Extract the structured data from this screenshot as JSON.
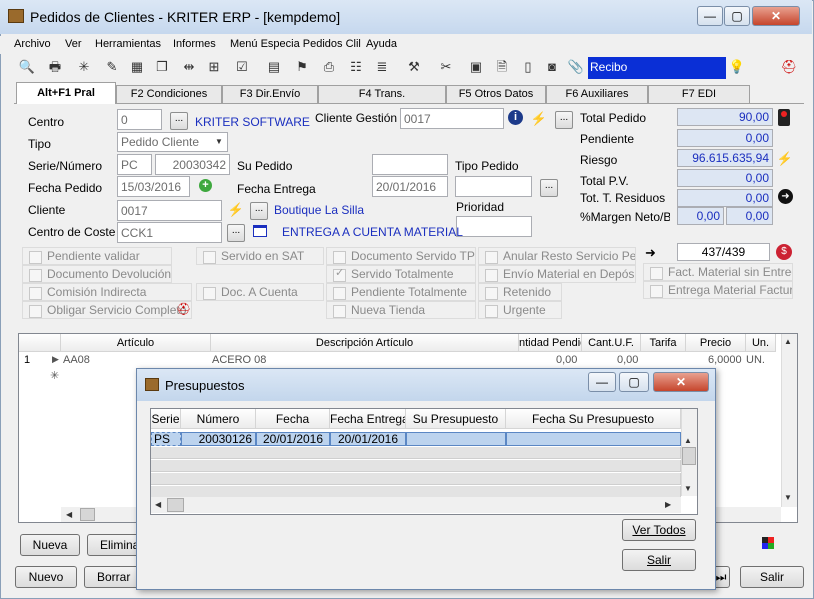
{
  "window": {
    "title": "Pedidos de Clientes - KRITER ERP - [kempdemo]",
    "controls": [
      "—",
      "▢",
      "✕"
    ]
  },
  "menu": [
    "Archivo",
    "Ver",
    "Herramientas",
    "Informes",
    "Menú Especia Pedidos Clil",
    "Ayuda"
  ],
  "toolbar": {
    "recibo_label": "Recibo"
  },
  "tabs": [
    "Alt+F1 Pral",
    "F2 Condiciones",
    "F3 Dir.Envío",
    "F4 Trans.",
    "F5 Otros Datos",
    "F6 Auxiliares",
    "F7 EDI"
  ],
  "form": {
    "centro_label": "Centro",
    "centro_value": "0",
    "centro_name": "KRITER SOFTWARE",
    "cliente_gestion_label": "Cliente Gestión",
    "cliente_gestion_value": "0017",
    "tipo_label": "Tipo",
    "tipo_value": "Pedido Cliente",
    "serie_label": "Serie/Número",
    "serie_value": "PC",
    "numero_value": "20030342",
    "su_pedido_label": "Su Pedido",
    "tipo_pedido_label": "Tipo Pedido",
    "fecha_pedido_label": "Fecha Pedido",
    "fecha_pedido_value": "15/03/2016",
    "fecha_entrega_label": "Fecha Entrega",
    "fecha_entrega_value": "20/01/2016",
    "prioridad_label": "Prioridad",
    "cliente_label": "Cliente",
    "cliente_value": "0017",
    "cliente_name": "Boutique La Silla",
    "centro_coste_label": "Centro de Coste",
    "centro_coste_value": "CCK1",
    "centro_coste_name": "ENTREGA A CUENTA MATERIAL"
  },
  "totals": {
    "total_pedido_label": "Total Pedido",
    "total_pedido_value": "90,00",
    "pendiente_label": "Pendiente",
    "pendiente_value": "0,00",
    "riesgo_label": "Riesgo",
    "riesgo_value": "96.615.635,94",
    "total_pv_label": "Total P.V.",
    "total_pv_value": "0,00",
    "tot_residuos_label": "Tot. T. Residuos",
    "tot_residuos_value": "0,00",
    "margen_label": "%Margen Neto/Br",
    "margen_neto_value": "0,00",
    "margen_bruto_value": "0,00",
    "counter": "437/439"
  },
  "checkboxes": {
    "col1": [
      "Pendiente validar",
      "Documento Devolución",
      "Comisión Indirecta",
      "Obligar Servicio Completo"
    ],
    "col2": [
      "Servido en SAT",
      "Doc. A Cuenta"
    ],
    "col3": [
      "Documento Servido TPV",
      "Servido Totalmente",
      "Pendiente Totalmente",
      "Nueva Tienda"
    ],
    "col4": [
      "Anular Resto Servicio Ped.",
      "Envío Material en Depósito",
      "Retenido",
      "Urgente"
    ],
    "col5": [
      "Fact. Material sin Entrega",
      "Entrega Material Facturad"
    ]
  },
  "lines_grid": {
    "headers": [
      "Artículo",
      "Descripción Artículo",
      "ntidad Pendie",
      "Cant.U.F.",
      "Tarifa",
      "Precio",
      "Un."
    ],
    "rows": [
      {
        "num": "1",
        "articulo": "AA08",
        "descripcion": "ACERO 08",
        "pendiente": "0,00",
        "cant": "0,00",
        "tarifa": "",
        "precio": "6,0000",
        "un": "UN."
      }
    ]
  },
  "bottom_buttons": {
    "nueva": "Nueva",
    "eliminar": "Eliminar",
    "nuevo": "Nuevo",
    "borrar": "Borrar",
    "salir": "Salir"
  },
  "dialog": {
    "title": "Presupuestos",
    "headers": [
      "Serie",
      "Número",
      "Fecha",
      "Fecha Entrega",
      "Su Presupuesto",
      "Fecha Su Presupuesto"
    ],
    "rows": [
      {
        "serie": "PS",
        "numero": "20030126",
        "fecha": "20/01/2016",
        "fecha_entrega": "20/01/2016",
        "su_presupuesto": "",
        "fecha_su": ""
      }
    ],
    "ver_todos": "Ver Todos",
    "salir": "Salir"
  },
  "colors": {
    "titlebar": "#c6d8ee",
    "recibo_bg": "#0a2fd6",
    "link_blue": "#1b2fbf",
    "selected_row": "#bcd3ee"
  }
}
